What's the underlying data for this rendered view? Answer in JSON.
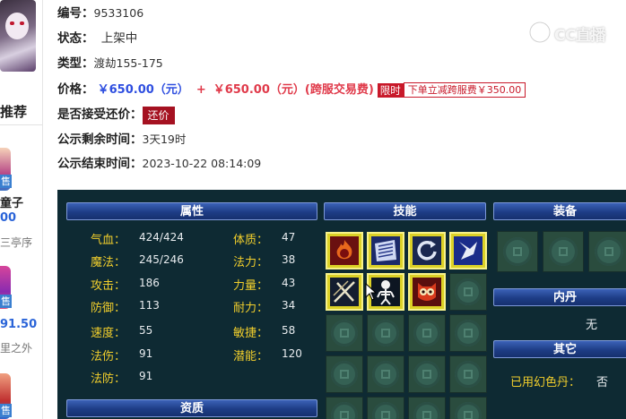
{
  "sidebar": {
    "title": "推荐",
    "items": [
      {
        "tag": "售",
        "name": "童子",
        "price": "00",
        "desc": "三亭序"
      },
      {
        "tag": "售",
        "price": "91.50",
        "desc": "里之外"
      },
      {
        "tag": "售"
      }
    ]
  },
  "detail": {
    "id_label": "编号：",
    "id_value": "9533106",
    "status_label": "状态：",
    "status_value": "上架中",
    "type_label": "类型：",
    "type_value": "渡劫155-175",
    "price_label": "价格：",
    "price_value": "￥650.00（元）",
    "price_plus": "+",
    "price_cross_value": "￥650.00（元）(跨服交易费)",
    "limit_tag": "限时",
    "discount_text": "下单立减跨服费￥350.00",
    "counter_label": "是否接受还价：",
    "counter_button": "还价",
    "remain_label": "公示剩余时间：",
    "remain_value": "3天19时",
    "end_label": "公示结束时间：",
    "end_value": "2023-10-22 08:14:09"
  },
  "watermark": {
    "text": "CC直播"
  },
  "panel": {
    "attributes_header": "属性",
    "skills_header": "技能",
    "equipment_header": "装备",
    "inner_dan_header": "内丹",
    "inner_dan_value": "无",
    "other_header": "其它",
    "resources_header": "资质",
    "attributes_left": [
      {
        "k": "气血：",
        "v": "424/424"
      },
      {
        "k": "魔法：",
        "v": "245/246"
      },
      {
        "k": "攻击：",
        "v": "186"
      },
      {
        "k": "防御：",
        "v": "113"
      },
      {
        "k": "速度：",
        "v": "55"
      },
      {
        "k": "法伤：",
        "v": "91"
      },
      {
        "k": "法防：",
        "v": "91"
      }
    ],
    "attributes_right": [
      {
        "k": "体质：",
        "v": "47"
      },
      {
        "k": "法力：",
        "v": "38"
      },
      {
        "k": "力量：",
        "v": "43"
      },
      {
        "k": "耐力：",
        "v": "34"
      },
      {
        "k": "敏捷：",
        "v": "58"
      },
      {
        "k": "潜能：",
        "v": "120"
      }
    ],
    "skills": [
      "fire-skill-icon",
      "scroll-skill-icon",
      "spin-skill-icon",
      "shield-skill-icon",
      "cross-swords-skill-icon",
      "skeleton-skill-icon",
      "owl-skill-icon"
    ],
    "other_label": "已用幻色丹：",
    "other_value": "否"
  }
}
